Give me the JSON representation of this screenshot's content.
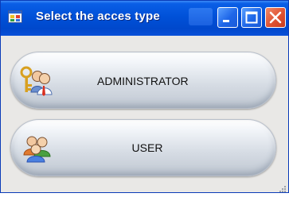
{
  "window": {
    "title": "Select the acces type",
    "icon": "app-window-icon",
    "controls": {
      "minimize": "minimize-icon",
      "maximize": "maximize-icon",
      "close": "close-icon"
    }
  },
  "buttons": [
    {
      "label": "ADMINISTRATOR",
      "icon": "admin-users-key-icon"
    },
    {
      "label": "USER",
      "icon": "users-icon"
    }
  ],
  "colors": {
    "titlebar": "#0051d8",
    "close": "#e05232",
    "button_face": "#d5dbe3"
  }
}
